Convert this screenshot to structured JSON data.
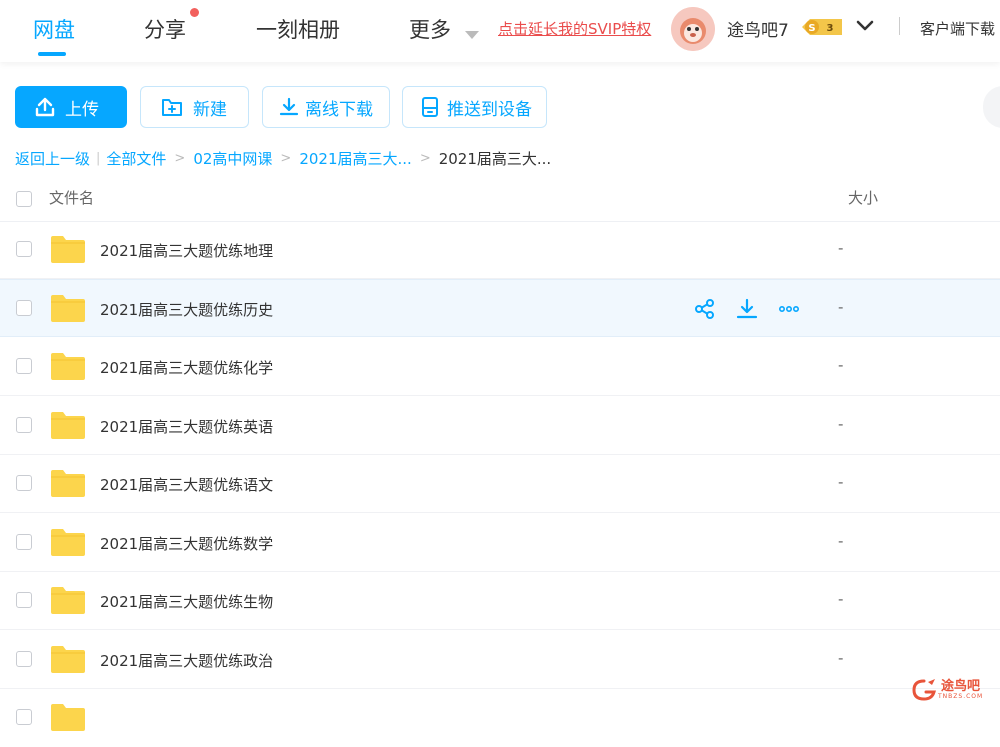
{
  "nav": {
    "items": [
      {
        "label": "网盘"
      },
      {
        "label": "分享"
      },
      {
        "label": "一刻相册"
      },
      {
        "label": "更多"
      }
    ],
    "svip_link": "点击延长我的SVIP特权",
    "username": "途鸟吧7",
    "vip_level": "3",
    "vip_letter": "S",
    "client_download": "客户端下载"
  },
  "toolbar": {
    "upload": "上传",
    "new": "新建",
    "offline": "离线下载",
    "push": "推送到设备"
  },
  "breadcrumb": {
    "back": "返回上一级",
    "items": [
      "全部文件",
      "02高中网课",
      "2021届高三大...",
      "2021届高三大..."
    ]
  },
  "list": {
    "header_name": "文件名",
    "header_size": "大小",
    "rows": [
      {
        "name": "2021届高三大题优练地理",
        "size": "-"
      },
      {
        "name": "2021届高三大题优练历史",
        "size": "-"
      },
      {
        "name": "2021届高三大题优练化学",
        "size": "-"
      },
      {
        "name": "2021届高三大题优练英语",
        "size": "-"
      },
      {
        "name": "2021届高三大题优练语文",
        "size": "-"
      },
      {
        "name": "2021届高三大题优练数学",
        "size": "-"
      },
      {
        "name": "2021届高三大题优练生物",
        "size": "-"
      },
      {
        "name": "2021届高三大题优练政治",
        "size": "-"
      }
    ]
  },
  "watermark": {
    "text": "途鸟吧",
    "sub": "TNBZS.COM"
  },
  "colors": {
    "accent": "#06a7ff",
    "svip": "#ea4c4c",
    "folder": "#fcd54c",
    "hover_row": "#f1f8fe"
  },
  "icons": [
    "upload-icon",
    "new-folder-icon",
    "download-icon",
    "device-icon",
    "share-icon",
    "more-icon",
    "folder-icon",
    "chevron-down-icon"
  ]
}
